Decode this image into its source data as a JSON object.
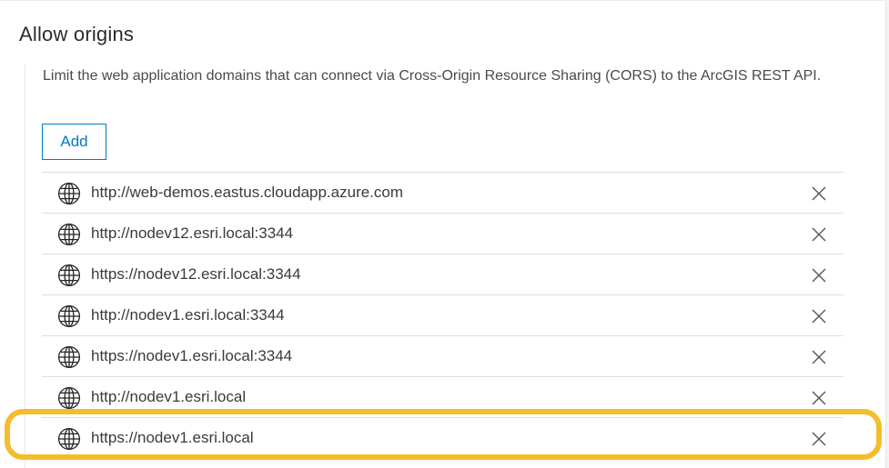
{
  "section": {
    "title": "Allow origins",
    "description": "Limit the web application domains that can connect via Cross-Origin Resource Sharing (CORS) to the ArcGIS REST API."
  },
  "actions": {
    "add_label": "Add"
  },
  "origins": [
    {
      "url": "http://web-demos.eastus.cloudapp.azure.com",
      "icon": "globe-icon",
      "remove_icon": "close-icon"
    },
    {
      "url": "http://nodev12.esri.local:3344",
      "icon": "globe-icon",
      "remove_icon": "close-icon"
    },
    {
      "url": "https://nodev12.esri.local:3344",
      "icon": "globe-icon",
      "remove_icon": "close-icon"
    },
    {
      "url": "http://nodev1.esri.local:3344",
      "icon": "globe-icon",
      "remove_icon": "close-icon"
    },
    {
      "url": "https://nodev1.esri.local:3344",
      "icon": "globe-icon",
      "remove_icon": "close-icon"
    },
    {
      "url": "http://nodev1.esri.local",
      "icon": "globe-icon",
      "remove_icon": "close-icon"
    },
    {
      "url": "https://nodev1.esri.local",
      "icon": "globe-icon",
      "remove_icon": "close-icon"
    }
  ],
  "colors": {
    "accent": "#007ac2",
    "highlight": "#f3bd2c",
    "text": "#3a3a3a",
    "divider": "#dedede"
  }
}
